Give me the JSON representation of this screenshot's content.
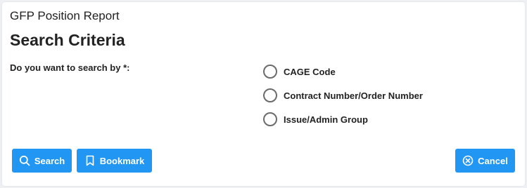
{
  "report": {
    "title": "GFP Position Report"
  },
  "criteria": {
    "heading": "Search Criteria",
    "question": "Do you want to search by *:",
    "options": [
      {
        "label": "CAGE Code",
        "selected": false
      },
      {
        "label": "Contract Number/Order Number",
        "selected": false
      },
      {
        "label": "Issue/Admin Group",
        "selected": false
      }
    ]
  },
  "actions": {
    "search_label": "Search",
    "search_icon": "search-icon",
    "bookmark_label": "Bookmark",
    "bookmark_icon": "bookmark-icon",
    "cancel_label": "Cancel",
    "cancel_icon": "cancel-circle-icon"
  },
  "colors": {
    "primary": "#2196f3",
    "background": "#eef0f3",
    "card": "#ffffff",
    "text": "#222222"
  }
}
